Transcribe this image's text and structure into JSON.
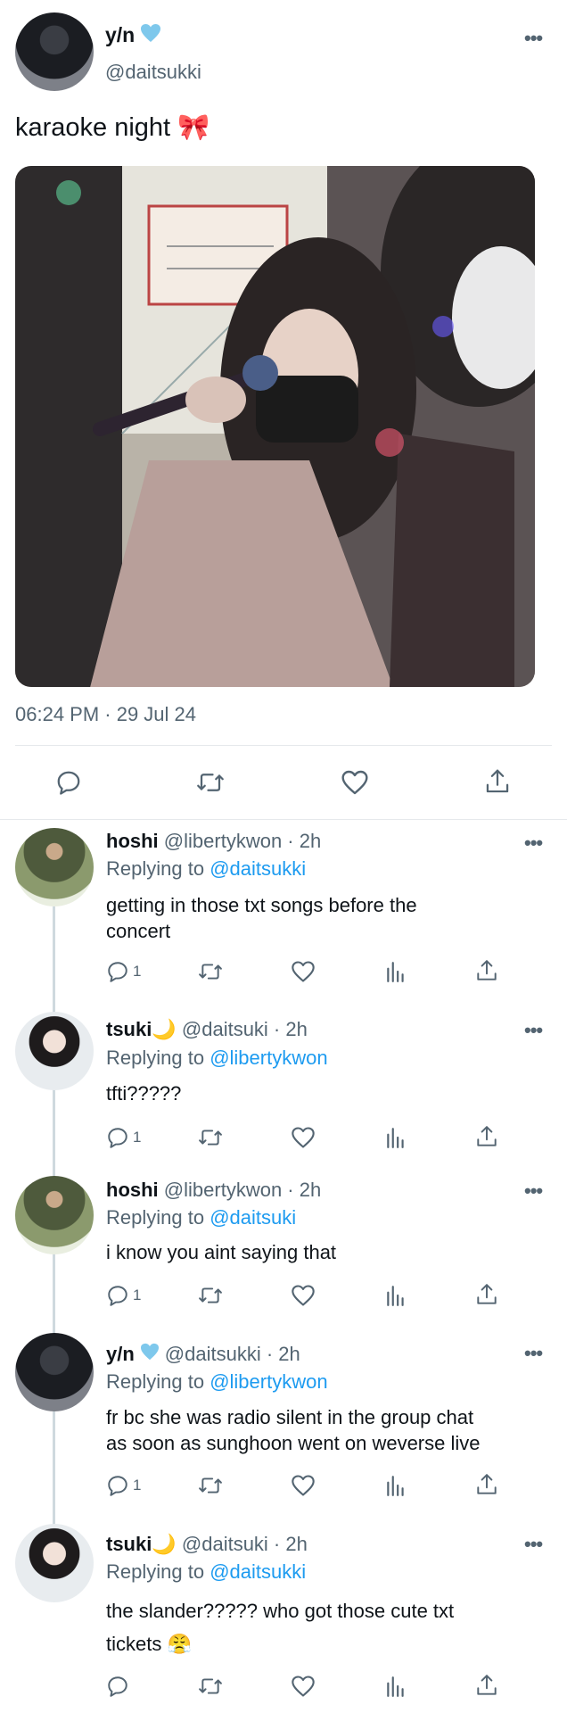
{
  "main_tweet": {
    "display_name": "y/n",
    "handle": "@daitsukki",
    "text": "karaoke night 🎀",
    "timestamp": "06:24 PM · 29 Jul 24"
  },
  "replies": [
    {
      "display_name": "hoshi",
      "handle_time": "@libertykwon · 2h",
      "replying_prefix": "Replying to",
      "replying_to": "@daitsukki",
      "text_lines": [
        "getting in those txt songs before the",
        "concert"
      ],
      "reply_count": "1",
      "avatar": "green"
    },
    {
      "display_name": "tsuki",
      "moon": "🌙",
      "handle_time": "@daitsuki · 2h",
      "replying_prefix": "Replying to",
      "replying_to": "@libertykwon",
      "text_lines": [
        "tfti?????"
      ],
      "reply_count": "1",
      "avatar": "light"
    },
    {
      "display_name": "hoshi",
      "handle_time": "@libertykwon · 2h",
      "replying_prefix": "Replying to",
      "replying_to": "@daitsuki",
      "text_lines": [
        "i know you aint saying that"
      ],
      "reply_count": "1",
      "avatar": "green"
    },
    {
      "display_name": "y/n",
      "verified": true,
      "handle_time": "@daitsukki · 2h",
      "replying_prefix": "Replying to",
      "replying_to": "@libertykwon",
      "text_lines": [
        "fr bc she was radio silent in the group chat",
        "as soon as sunghoon went on weverse live"
      ],
      "reply_count": "1",
      "avatar": "dark"
    },
    {
      "display_name": "tsuki",
      "moon": "🌙",
      "handle_time": "@daitsuki · 2h",
      "replying_prefix": "Replying to",
      "replying_to": "@daitsukki",
      "text_lines": [
        "the slander????? who got those cute txt",
        "tickets 😤"
      ],
      "reply_count": "",
      "avatar": "light"
    }
  ],
  "icons": {
    "reply": "speech-bubble",
    "retweet": "retweet-arrows",
    "like": "heart",
    "views": "bar-chart",
    "share": "upload-arrow",
    "more": "ellipsis",
    "verified": "verified-heart"
  },
  "colors": {
    "link": "#1d9bf0",
    "muted": "#536471",
    "verified": "#7ec8ec"
  }
}
